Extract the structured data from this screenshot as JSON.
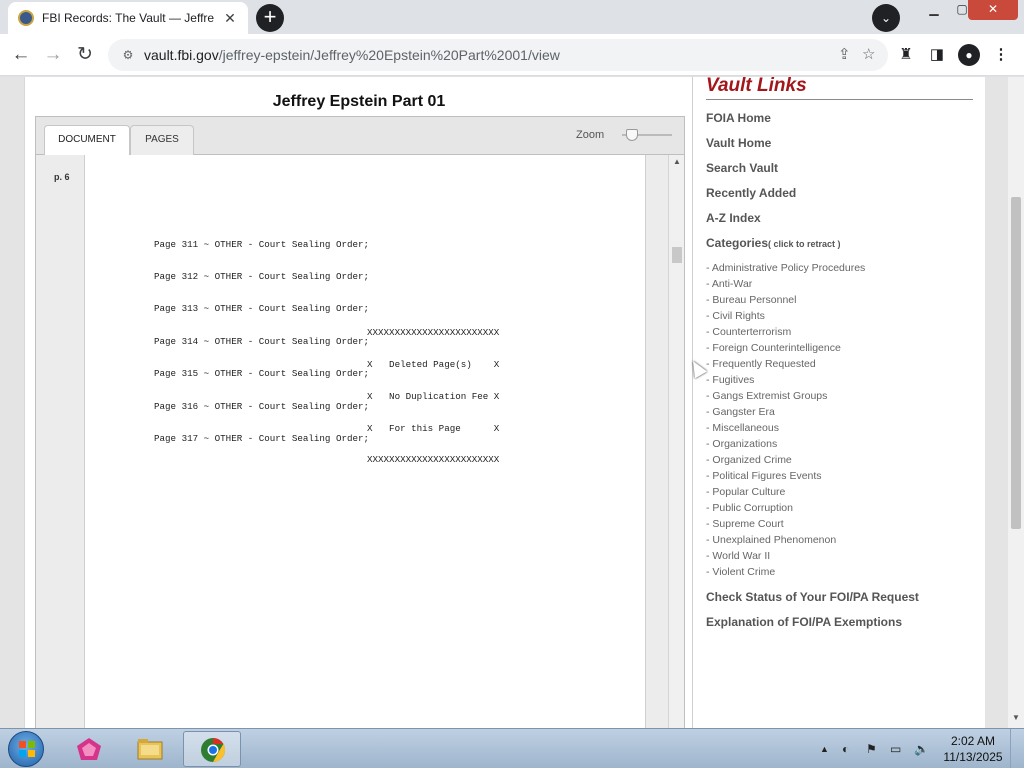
{
  "browser": {
    "tab_title": "FBI Records: The Vault — Jeffrey Epstein",
    "tab_close": "✕",
    "new_tab": "+",
    "tab_search": "⌄",
    "url_host": "vault.fbi.gov",
    "url_path": "/jeffrey-epstein/Jeffrey%20Epstein%20Part%2001/view"
  },
  "document": {
    "title": "Jeffrey Epstein Part 01",
    "tabs": [
      "DOCUMENT",
      "PAGES"
    ],
    "zoom_label": "Zoom",
    "page_label": "p. 6",
    "lines": [
      "Page 311 ~ OTHER - Court Sealing Order;",
      "Page 312 ~ OTHER - Court Sealing Order;",
      "Page 313 ~ OTHER - Court Sealing Order;",
      "Page 314 ~ OTHER - Court Sealing Order;",
      "Page 315 ~ OTHER - Court Sealing Order;",
      "Page 316 ~ OTHER - Court Sealing Order;",
      "Page 317 ~ OTHER - Court Sealing Order;"
    ],
    "deleted_box": [
      "XXXXXXXXXXXXXXXXXXXXXXXX",
      "X   Deleted Page(s)    X",
      "X   No Duplication Fee X",
      "X   For this Page      X",
      "XXXXXXXXXXXXXXXXXXXXXXXX"
    ]
  },
  "sidebar": {
    "title": "Vault Links",
    "links": [
      "FOIA Home",
      "Vault Home",
      "Search Vault",
      "Recently Added",
      "A-Z Index"
    ],
    "categories_label": "Categories",
    "categories_retract": "( click to retract )",
    "categories": [
      "- Administrative Policy Procedures",
      "- Anti-War",
      "- Bureau Personnel",
      "- Civil Rights",
      "- Counterterrorism",
      "- Foreign Counterintelligence",
      "- Frequently Requested",
      "- Fugitives",
      "- Gangs Extremist Groups",
      "- Gangster Era",
      "- Miscellaneous",
      "- Organizations",
      "- Organized Crime",
      "- Political Figures Events",
      "- Popular Culture",
      "- Public Corruption",
      "- Supreme Court",
      "- Unexplained Phenomenon",
      "- World War II",
      "- Violent Crime"
    ],
    "bottom_links": [
      "Check Status of Your FOI/PA Request",
      "Explanation of FOI/PA Exemptions"
    ]
  },
  "taskbar": {
    "time": "2:02 AM",
    "date": "11/13/2025"
  },
  "colors": {
    "vault_red": "#a3161a",
    "link_gray": "#555555"
  }
}
